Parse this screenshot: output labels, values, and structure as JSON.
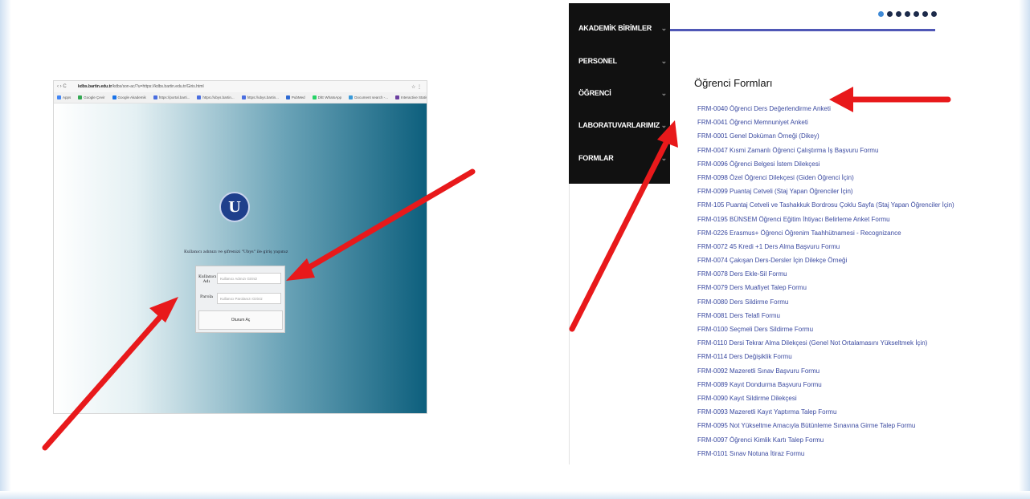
{
  "left_shot": {
    "url_domain": "kdbs.bartin.edu.tr",
    "url_rest": "/kdbs/son-ac/?u=https://kdbs.bartin.edu.tr/Giris.html",
    "bookmarks": [
      "Apps",
      "Google Çevir",
      "Google Akademik",
      "https://portal.barti...",
      "https://ubys.bartin...",
      "https://ubys.bartin...",
      "PubMed",
      "DİE WhatsApp",
      "Document search -...",
      "Interactive Statisti...",
      "Dil İçerikleri ve..."
    ],
    "login_notice": "Kullanıcı adınızı ve şifrenizi \"Ubys\" ile giriş yapınız",
    "username_label": "Kullanıcı Adı",
    "username_placeholder": "Kullanıcı Adınızı Giriniz",
    "password_label": "Parola",
    "password_placeholder": "Kullanıcı Parolanızı Giriniz",
    "login_button": "Oturum Aç"
  },
  "right_shot": {
    "sidebar": [
      {
        "label": "AKADEMİK BİRİMLER"
      },
      {
        "label": "PERSONEL"
      },
      {
        "label": "ÖĞRENCİ"
      },
      {
        "label": "LABORATUVARLARIMIZ"
      },
      {
        "label": "FORMLAR"
      }
    ],
    "forms_title": "Öğrenci Formları",
    "forms": [
      "FRM-0040 Öğrenci Ders Değerlendirme Anketi",
      "FRM-0041 Öğrenci Memnuniyet Anketi",
      "FRM-0001 Genel Doküman Örneği (Dikey)",
      "FRM-0047 Kısmi Zamanlı Öğrenci Çalıştırma İş Başvuru Formu",
      "FRM-0096 Öğrenci Belgesi İstem Dilekçesi",
      "FRM-0098 Özel Öğrenci Dilekçesi (Giden Öğrenci İçin)",
      "FRM-0099 Puantaj Cetveli (Staj Yapan Öğrenciler İçin)",
      "FRM-105 Puantaj Cetveli ve Tashakkuk Bordrosu Çoklu Sayfa (Staj Yapan Öğrenciler İçin)",
      "FRM-0195 BÜNSEM Öğrenci Eğitim İhtiyacı Belirleme Anket Formu",
      "FRM-0226 Erasmus+ Öğrenci Öğrenim Taahhütnamesi - Recognizance",
      "FRM-0072 45 Kredi +1 Ders Alma Başvuru Formu",
      "FRM-0074 Çakışan Ders-Dersler İçin Dilekçe Örneği",
      "FRM-0078 Ders Ekle-Sil Formu",
      "FRM-0079 Ders Muafiyet Talep Formu",
      "FRM-0080 Ders Sildirme Formu",
      "FRM-0081 Ders Telafi Formu",
      "FRM-0100 Seçmeli Ders Sildirme Formu",
      "FRM-0110 Dersi Tekrar Alma Dilekçesi (Genel Not Ortalamasını Yükseltmek İçin)",
      "FRM-0114 Ders Değişiklik Formu",
      "FRM-0092 Mazeretli Sınav Başvuru Formu",
      "FRM-0089 Kayıt Dondurma Başvuru Formu",
      "FRM-0090 Kayıt Sildirme Dilekçesi",
      "FRM-0093 Mazeretli Kayıt Yaptırma Talep Formu",
      "FRM-0095 Not Yükseltme Amacıyla Bütünleme Sınavına Girme Talep Formu",
      "FRM-0097 Öğrenci Kimlik Kartı Talep Formu",
      "FRM-0101 Sınav Notuna İtiraz Formu"
    ]
  },
  "colors": {
    "arrow": "#e8191b",
    "sidebar_bg": "#111111",
    "link": "#3b4aa0",
    "gradient_end": "#0d5f7d"
  },
  "icons": [
    "university-seal-icon",
    "chevron-down-icon",
    "arrow-icon",
    "slider-dots-icon"
  ]
}
